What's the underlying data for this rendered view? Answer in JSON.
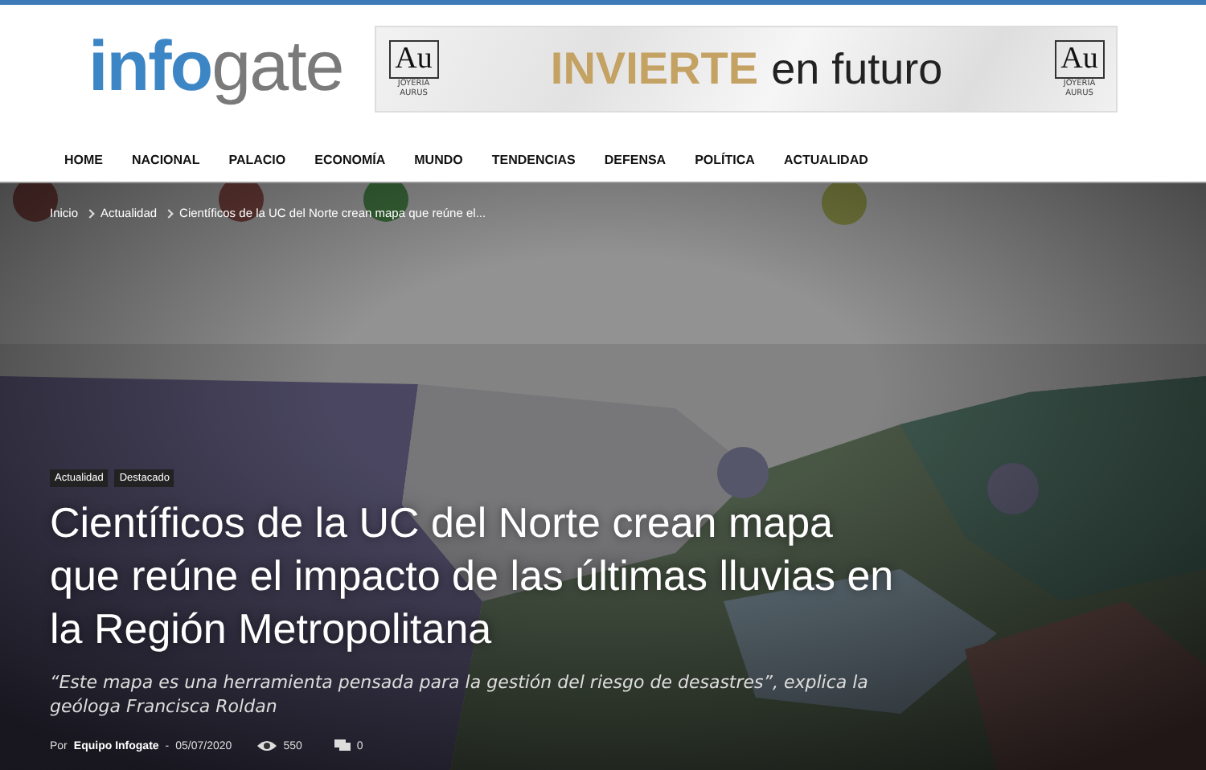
{
  "logo": {
    "accent": "info",
    "rest": "gate"
  },
  "ad": {
    "brands": [
      {
        "mark": "Au",
        "name": "JOYERÍA AURUS"
      },
      {
        "mark": "Au",
        "name": "JOYERÍA AURUS"
      }
    ],
    "headline": "INVIERTE",
    "tagline": "en futuro"
  },
  "nav": [
    "HOME",
    "NACIONAL",
    "PALACIO",
    "ECONOMÍA",
    "MUNDO",
    "TENDENCIAS",
    "DEFENSA",
    "POLÍTICA",
    "ACTUALIDAD"
  ],
  "breadcrumb": [
    "Inicio",
    "Actualidad",
    "Científicos de la UC del Norte crean mapa que reúne el..."
  ],
  "article": {
    "tags": [
      "Actualidad",
      "Destacado"
    ],
    "title": "Científicos de la UC del Norte crean mapa que reúne el impacto de las últimas lluvias en la Región Metropolitana",
    "subtitle": "“Este mapa es una herramienta pensada para la gestión del riesgo de desastres”, explica la geóloga Francisca Roldan",
    "by": "Por",
    "author": "Equipo Infogate",
    "separator": "-",
    "date": "05/07/2020",
    "views": "550",
    "comments": "0"
  }
}
